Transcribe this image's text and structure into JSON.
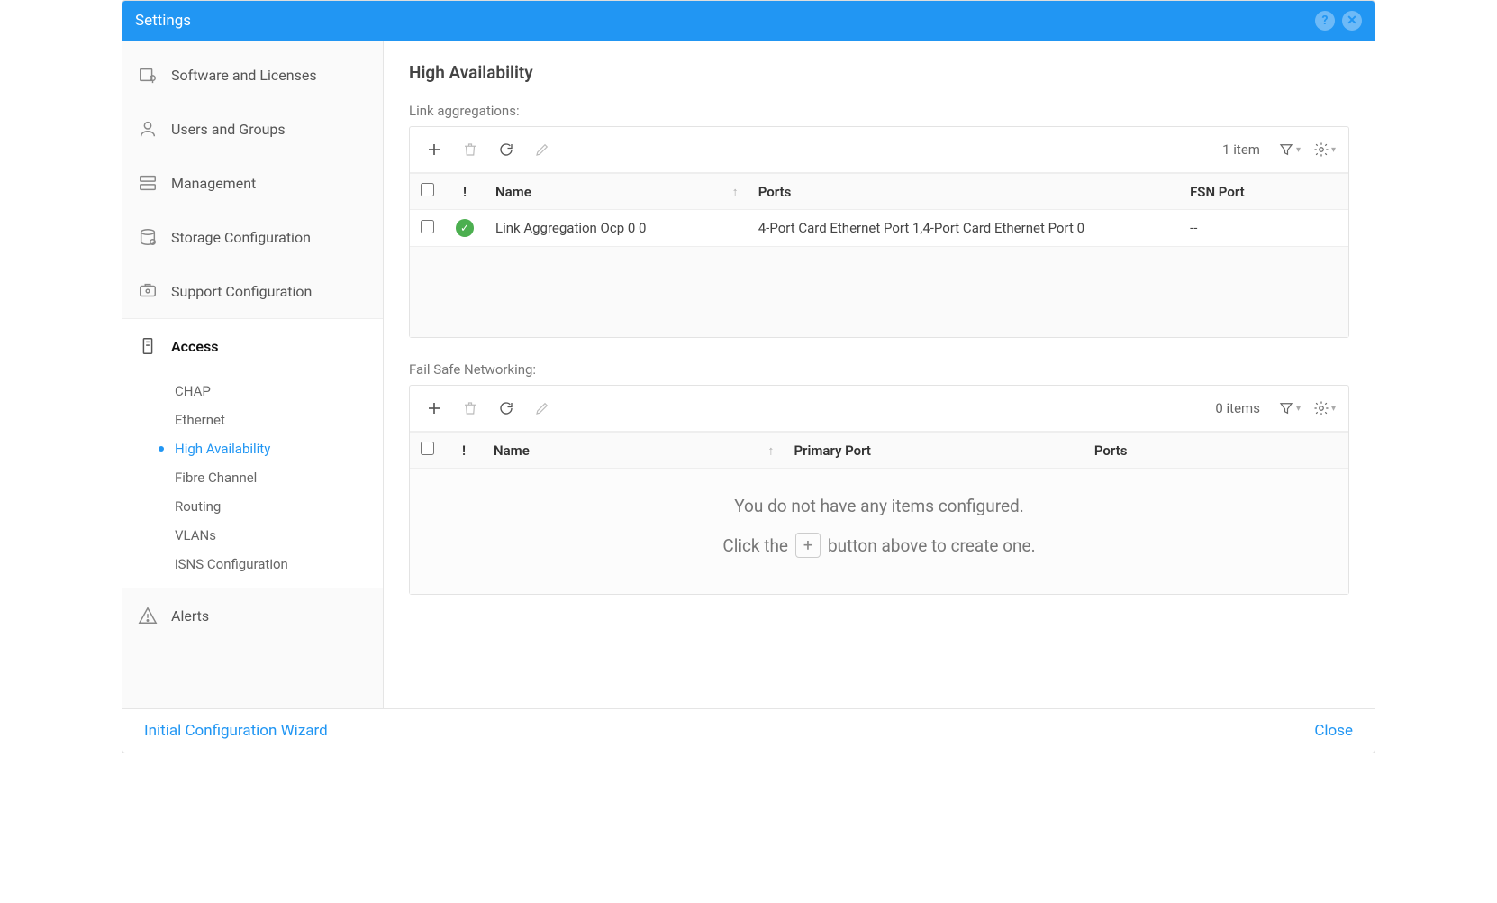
{
  "titlebar": {
    "title": "Settings"
  },
  "sidebar": {
    "items": [
      {
        "label": "Software and Licenses"
      },
      {
        "label": "Users and Groups"
      },
      {
        "label": "Management"
      },
      {
        "label": "Storage Configuration"
      },
      {
        "label": "Support Configuration"
      },
      {
        "label": "Access"
      },
      {
        "label": "Alerts"
      }
    ],
    "access_subitems": [
      {
        "label": "CHAP"
      },
      {
        "label": "Ethernet"
      },
      {
        "label": "High Availability"
      },
      {
        "label": "Fibre Channel"
      },
      {
        "label": "Routing"
      },
      {
        "label": "VLANs"
      },
      {
        "label": "iSNS Configuration"
      }
    ]
  },
  "page": {
    "title": "High Availability"
  },
  "link_agg": {
    "label": "Link aggregations:",
    "count_text": "1 item",
    "columns": {
      "status": "!",
      "name": "Name",
      "ports": "Ports",
      "fsn": "FSN Port"
    },
    "rows": [
      {
        "name": "Link Aggregation Ocp 0 0",
        "ports": "4-Port Card Ethernet Port 1,4-Port Card Ethernet Port 0",
        "fsn": "--"
      }
    ]
  },
  "fsn": {
    "label": "Fail Safe Networking:",
    "count_text": "0 items",
    "columns": {
      "status": "!",
      "name": "Name",
      "primary": "Primary Port",
      "ports": "Ports"
    },
    "empty": {
      "line1": "You do not have any items configured.",
      "line2a": "Click the",
      "line2b": "button above to create one."
    }
  },
  "footer": {
    "wizard": "Initial Configuration Wizard",
    "close": "Close"
  }
}
